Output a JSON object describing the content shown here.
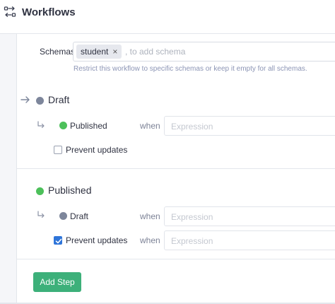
{
  "header": {
    "title": "Workflows",
    "icon": "workflow-arrows-icon"
  },
  "schemas": {
    "label": "Schemas",
    "tags": [
      {
        "label": "student",
        "remove": "×"
      }
    ],
    "placeholder": ", to add schema",
    "hint": "Restrict this workflow to specific schemas or keep it empty for all schemas."
  },
  "steps": [
    {
      "name": "Draft",
      "color": "#7d869b",
      "is_initial": true,
      "transitions": [
        {
          "target": "Published",
          "target_color": "#4cc05a",
          "when": "when",
          "expression_placeholder": "Expression"
        }
      ],
      "prevent_updates": {
        "label": "Prevent updates",
        "checked": false
      }
    },
    {
      "name": "Published",
      "color": "#4cc05a",
      "is_initial": false,
      "transitions": [
        {
          "target": "Draft",
          "target_color": "#7d869b",
          "when": "when",
          "expression_placeholder": "Expression"
        }
      ],
      "prevent_updates": {
        "label": "Prevent updates",
        "checked": true,
        "when": "when",
        "expression_placeholder": "Expression"
      }
    }
  ],
  "actions": {
    "add_step": "Add Step"
  },
  "colors": {
    "accent_green": "#3db07a",
    "checkbox_blue": "#2f75d9"
  }
}
